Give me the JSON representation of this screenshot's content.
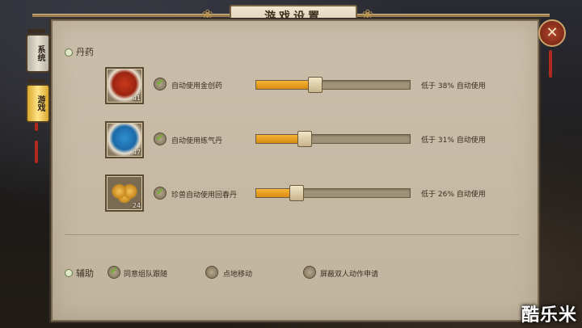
{
  "window": {
    "title": "游戏设置"
  },
  "side_tabs": [
    {
      "label": "系统",
      "active": false
    },
    {
      "label": "游戏",
      "active": true
    }
  ],
  "close_icon": "close-x-icon",
  "potions": {
    "section_title": "丹药",
    "items": [
      {
        "icon": "red-powder-icon",
        "count": "41",
        "label": "自动使用金创药",
        "checked": true,
        "threshold_percent": 38,
        "threshold_text": "低于 38% 自动使用"
      },
      {
        "icon": "blue-powder-icon",
        "count": "47",
        "label": "自动使用练气丹",
        "checked": true,
        "threshold_percent": 31,
        "threshold_text": "低于 31% 自动使用"
      },
      {
        "icon": "golden-pills-icon",
        "count": "24",
        "label": "珍兽自动使用回春丹",
        "checked": true,
        "threshold_percent": 26,
        "threshold_text": "低于 26% 自动使用"
      }
    ]
  },
  "assist": {
    "section_title": "辅助",
    "options": [
      {
        "label": "同意组队跟随",
        "checked": true
      },
      {
        "label": "点地移动",
        "checked": false
      },
      {
        "label": "屏蔽双人动作申请",
        "checked": false
      }
    ]
  },
  "watermark": "酷乐米",
  "colors": {
    "accent": "#f0a623",
    "check_green": "#6fb02c",
    "panel": "#c6baa5"
  }
}
